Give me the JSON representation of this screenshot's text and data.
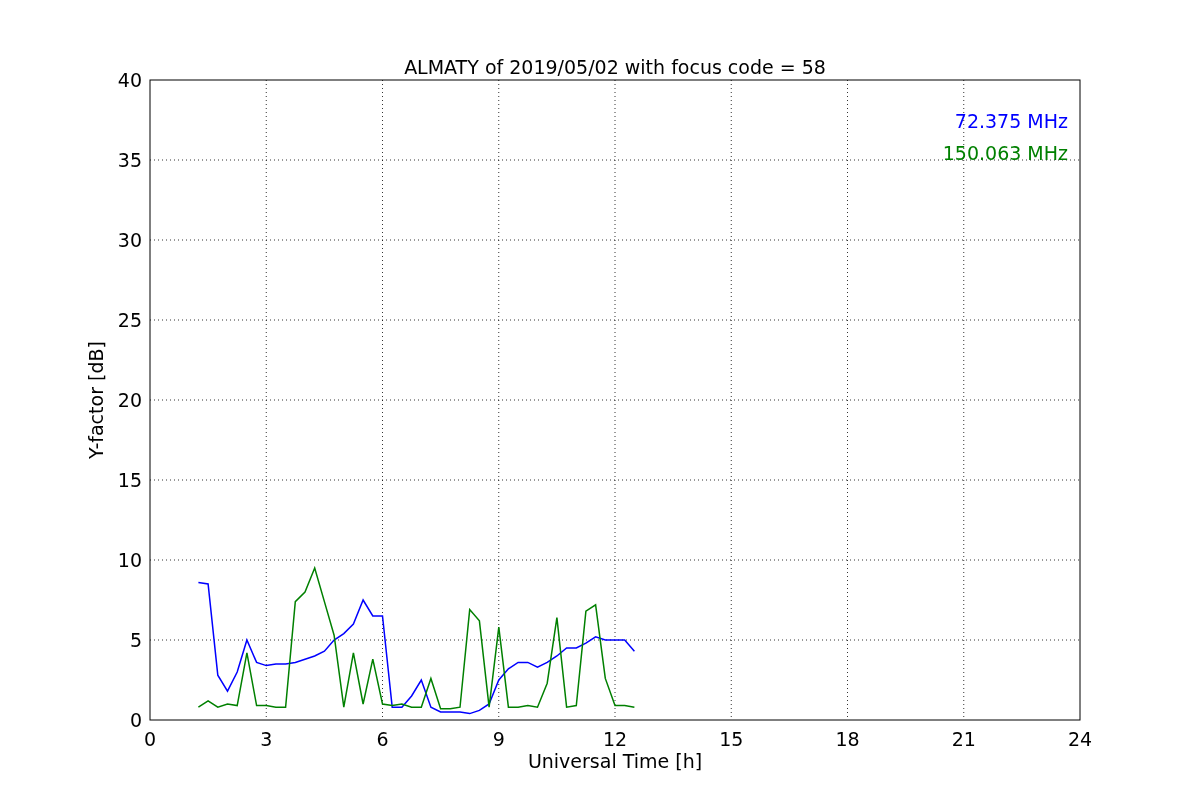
{
  "chart_data": {
    "type": "line",
    "title": "ALMATY of 2019/05/02 with focus code = 58",
    "xlabel": "Universal Time [h]",
    "ylabel": "Y-factor [dB]",
    "x": [
      1.25,
      1.5,
      1.75,
      2.0,
      2.25,
      2.5,
      2.75,
      3.0,
      3.25,
      3.5,
      3.75,
      4.0,
      4.25,
      4.5,
      4.75,
      5.0,
      5.25,
      5.5,
      5.75,
      6.0,
      6.25,
      6.5,
      6.75,
      7.0,
      7.25,
      7.5,
      7.75,
      8.0,
      8.25,
      8.5,
      8.75,
      9.0,
      9.25,
      9.5,
      9.75,
      10.0,
      10.25,
      10.5,
      10.75,
      11.0,
      11.25,
      11.5,
      11.75,
      12.0,
      12.25,
      12.5
    ],
    "series": [
      {
        "name": "72.375 MHz",
        "color": "#0000ff",
        "values": [
          8.6,
          8.5,
          2.8,
          1.8,
          3.0,
          5.0,
          3.6,
          3.4,
          3.5,
          3.5,
          3.6,
          3.8,
          4.0,
          4.3,
          5.0,
          5.4,
          6.0,
          7.5,
          6.5,
          6.5,
          0.8,
          0.8,
          1.5,
          2.5,
          0.8,
          0.5,
          0.5,
          0.5,
          0.4,
          0.6,
          1.0,
          2.5,
          3.2,
          3.6,
          3.6,
          3.3,
          3.6,
          4.0,
          4.5,
          4.5,
          4.8,
          5.2,
          5.0,
          5.0,
          5.0,
          4.3
        ]
      },
      {
        "name": "150.063 MHz",
        "color": "#008000",
        "values": [
          0.8,
          1.2,
          0.8,
          1.0,
          0.9,
          4.2,
          0.9,
          0.9,
          0.8,
          0.8,
          7.4,
          8.0,
          9.5,
          7.4,
          5.3,
          0.8,
          4.2,
          1.0,
          3.8,
          1.0,
          0.9,
          1.0,
          0.8,
          0.8,
          2.6,
          0.7,
          0.7,
          0.8,
          6.9,
          6.2,
          0.8,
          5.8,
          0.8,
          0.8,
          0.9,
          0.8,
          2.3,
          6.4,
          0.8,
          0.9,
          6.8,
          7.2,
          2.6,
          0.9,
          0.9,
          0.8
        ]
      }
    ],
    "grid": true,
    "xlim": [
      0,
      24
    ],
    "ylim": [
      0,
      40
    ],
    "xticks": [
      0,
      3,
      6,
      9,
      12,
      15,
      18,
      21,
      24
    ],
    "yticks": [
      0,
      5,
      10,
      15,
      20,
      25,
      30,
      35,
      40
    ]
  }
}
